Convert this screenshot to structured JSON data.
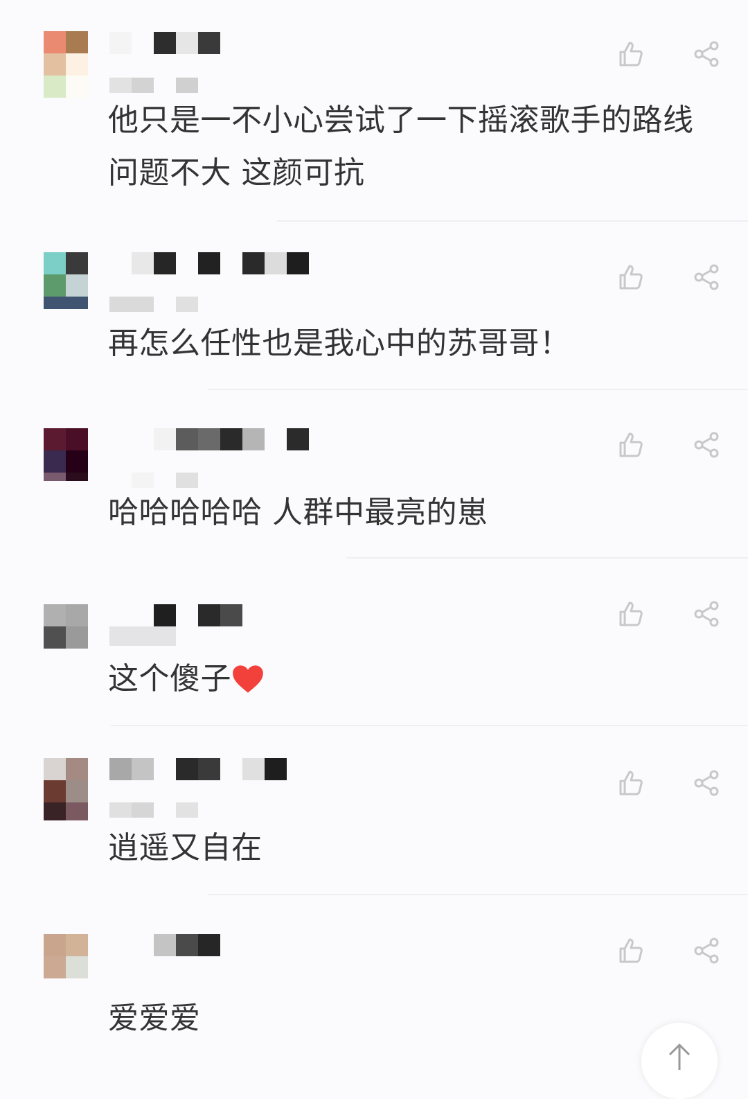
{
  "comments": [
    {
      "text": "他只是一不小心尝试了一下摇滚歌手的路线 问题不大 这颜可抗",
      "has_heart": false
    },
    {
      "text": "再怎么任性也是我心中的苏哥哥！",
      "has_heart": false
    },
    {
      "text": "哈哈哈哈哈 人群中最亮的崽",
      "has_heart": false
    },
    {
      "text": "这个傻子",
      "has_heart": true
    },
    {
      "text": "逍遥又自在",
      "has_heart": false
    },
    {
      "text": "爱爱爱",
      "has_heart": false
    }
  ],
  "icons": {
    "like": "thumbs-up-icon",
    "share": "share-icon",
    "scroll_top": "arrow-up-icon",
    "heart": "heart-emoji"
  },
  "colors": {
    "background": "#fbfafc",
    "text": "#333333",
    "icon": "#c8c8cc",
    "heart": "#f2403b"
  }
}
